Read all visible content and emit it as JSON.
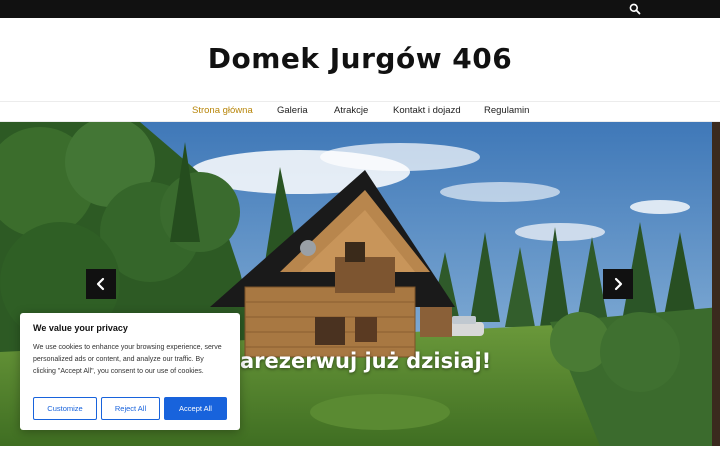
{
  "site": {
    "title": "Domek Jurgów 406"
  },
  "topbar": {
    "search_icon": "search-icon"
  },
  "nav": {
    "items": [
      {
        "label": "Strona główna",
        "active": true
      },
      {
        "label": "Galeria",
        "active": false
      },
      {
        "label": "Atrakcje",
        "active": false
      },
      {
        "label": "Kontakt i dojazd",
        "active": false
      },
      {
        "label": "Regulamin",
        "active": false
      }
    ]
  },
  "hero": {
    "caption": "arezerwuj już dzisiaj!",
    "prev_icon": "chevron-left-icon",
    "next_icon": "chevron-right-icon"
  },
  "cookie": {
    "title": "We value your privacy",
    "text": "We use cookies to enhance your browsing experience, serve personalized ads or content, and analyze our traffic. By clicking \"Accept All\", you consent to our use of cookies.",
    "customize_label": "Customize",
    "reject_label": "Reject All",
    "accept_label": "Accept All"
  },
  "colors": {
    "accent": "#1863dc",
    "nav_active": "#b8860b",
    "topbar": "#111111"
  }
}
